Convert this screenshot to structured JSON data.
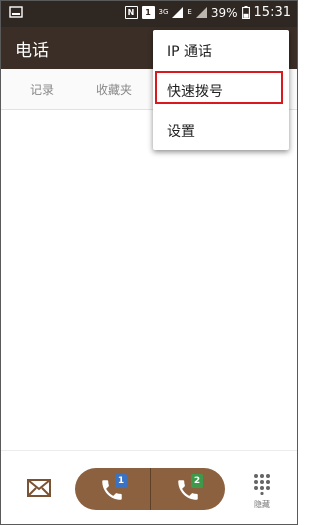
{
  "status_bar": {
    "nfc_icon": "nfc-icon",
    "sim_icon": "sim-1-icon",
    "network_3g": "3G",
    "network_e": "E",
    "battery": "39%",
    "time": "15:31"
  },
  "app_bar": {
    "title": "电话"
  },
  "tabs": [
    {
      "label": "记录"
    },
    {
      "label": "收藏夹"
    }
  ],
  "menu": {
    "items": [
      {
        "label": "IP 通话"
      },
      {
        "label": "快速拨号",
        "highlighted": true
      },
      {
        "label": "设置"
      }
    ]
  },
  "bottom_bar": {
    "message_icon": "envelope-icon",
    "call_sim1_badge": "1",
    "call_sim2_badge": "2",
    "keypad_label": "隐藏"
  },
  "colors": {
    "status_bar": "#2e2722",
    "app_bar": "#3b2e26",
    "call_button": "#8b6140",
    "highlight": "#d8191f"
  }
}
